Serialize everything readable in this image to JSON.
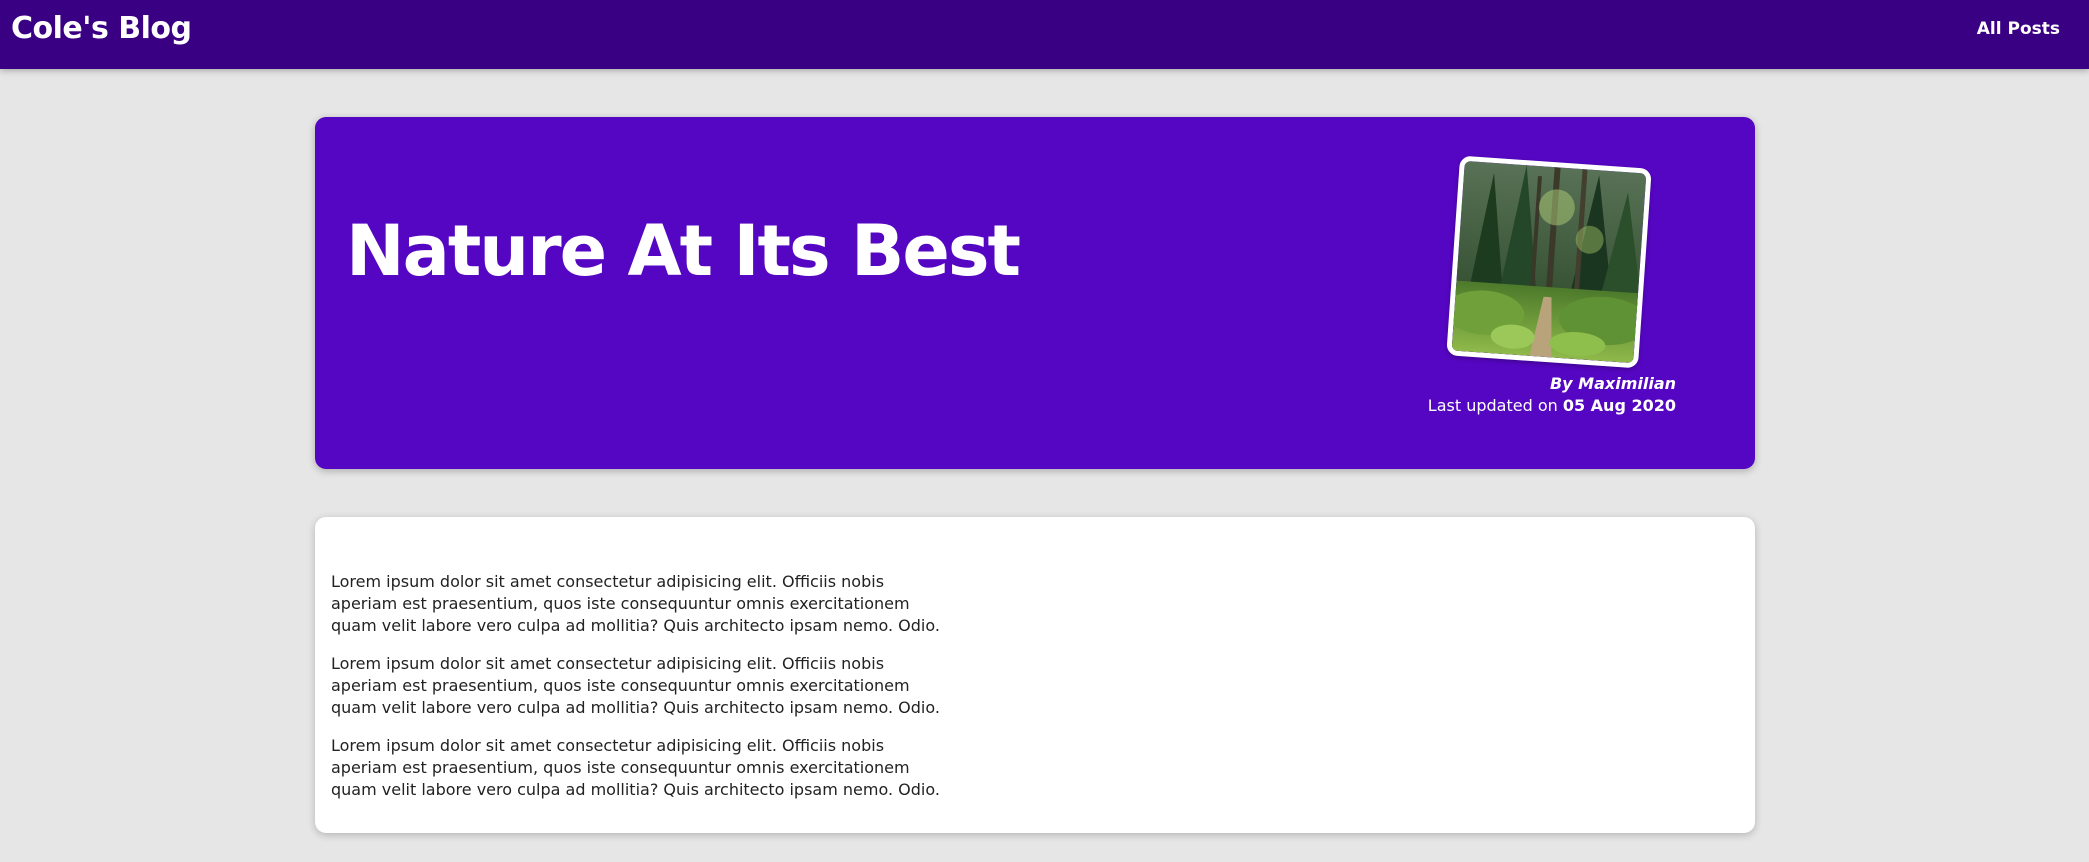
{
  "header": {
    "brand": "Cole's Blog",
    "nav_link": "All Posts"
  },
  "hero": {
    "title": "Nature At Its Best",
    "image_icon": "forest-photo",
    "author": "By Maximilian",
    "updated_prefix": "Last updated on ",
    "updated_date": "05 Aug 2020"
  },
  "content": {
    "paragraphs": [
      "Lorem ipsum dolor sit amet consectetur adipisicing elit. Officiis nobis aperiam est praesentium, quos iste consequuntur omnis exercitationem quam velit labore vero culpa ad mollitia? Quis architecto ipsam nemo. Odio.",
      "Lorem ipsum dolor sit amet consectetur adipisicing elit. Officiis nobis aperiam est praesentium, quos iste consequuntur omnis exercitationem quam velit labore vero culpa ad mollitia? Quis architecto ipsam nemo. Odio.",
      "Lorem ipsum dolor sit amet consectetur adipisicing elit. Officiis nobis aperiam est praesentium, quos iste consequuntur omnis exercitationem quam velit labore vero culpa ad mollitia? Quis architecto ipsam nemo. Odio."
    ]
  },
  "colors": {
    "header_bg": "#3a0083",
    "hero_bg": "#5506c2",
    "page_bg": "#e6e6e6",
    "card_bg": "#ffffff"
  }
}
